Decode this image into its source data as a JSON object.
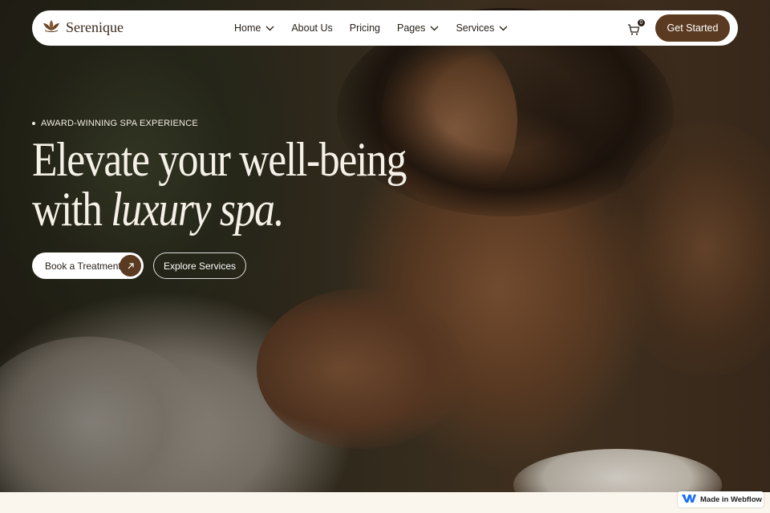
{
  "brand": {
    "name": "Serenique"
  },
  "nav": {
    "items": [
      {
        "label": "Home",
        "has_dropdown": true
      },
      {
        "label": "About Us",
        "has_dropdown": false
      },
      {
        "label": "Pricing",
        "has_dropdown": false
      },
      {
        "label": "Pages",
        "has_dropdown": true
      },
      {
        "label": "Services",
        "has_dropdown": true
      }
    ],
    "cart_count": "0",
    "cta_label": "Get Started"
  },
  "hero": {
    "eyebrow": "AWARD-WINNING SPA EXPERIENCE",
    "headline_line1": "Elevate your well-being",
    "headline_line2_plain": "with ",
    "headline_line2_italic": "luxury spa.",
    "primary_button": "Book a Treatment",
    "secondary_button": "Explore Services"
  },
  "badge": {
    "label": "Made in Webflow"
  },
  "colors": {
    "accent": "#5a3a20",
    "text_dark": "#2a211a",
    "page_bg": "#faf6ee"
  },
  "icons": [
    "lotus-logo-icon",
    "chevron-down-icon",
    "cart-icon",
    "arrow-up-right-icon",
    "webflow-logo-icon"
  ]
}
